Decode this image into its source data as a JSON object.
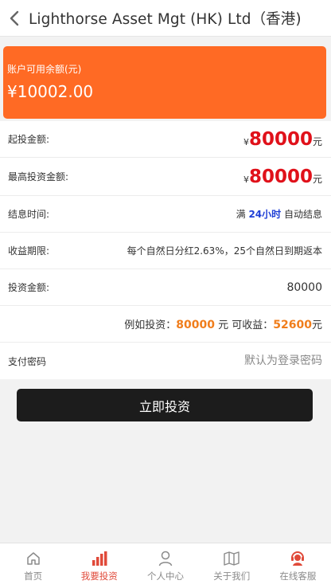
{
  "header": {
    "title": "Lighthorse Asset Mgt (HK) Ltd（香港)",
    "back_icon": "chevron-left-icon"
  },
  "balance": {
    "label": "账户可用余额(元)",
    "amount": "¥10002.00",
    "color": "#ff6a24"
  },
  "rows": {
    "min_invest": {
      "label": "起投金额:",
      "currency": "¥",
      "value": "80000",
      "unit": "元"
    },
    "max_invest": {
      "label": "最高投资金额:",
      "currency": "¥",
      "value": "80000",
      "unit": "元"
    },
    "settle_time": {
      "label": "结息时间:",
      "prefix": "满",
      "value": "24小时",
      "suffix": "自动结息"
    },
    "term": {
      "label": "收益期限:",
      "value": "每个自然日分红2.63%，25个自然日到期返本"
    },
    "amount": {
      "label": "投资金额:",
      "value": "80000"
    },
    "example": {
      "prefix": "例如投资：",
      "invest": "80000",
      "mid": "元 可收益：",
      "profit": "52600",
      "unit": "元"
    },
    "password": {
      "label": "支付密码",
      "placeholder": "默认为登录密码"
    }
  },
  "cta": {
    "label": "立即投资"
  },
  "tabbar": {
    "active_color": "#e04a3a",
    "items": [
      {
        "label": "首页",
        "icon": "home-icon"
      },
      {
        "label": "我要投资",
        "icon": "bar-chart-icon",
        "active": true
      },
      {
        "label": "个人中心",
        "icon": "user-icon"
      },
      {
        "label": "关于我们",
        "icon": "map-icon"
      },
      {
        "label": "在线客服",
        "icon": "support-agent-icon"
      }
    ]
  }
}
